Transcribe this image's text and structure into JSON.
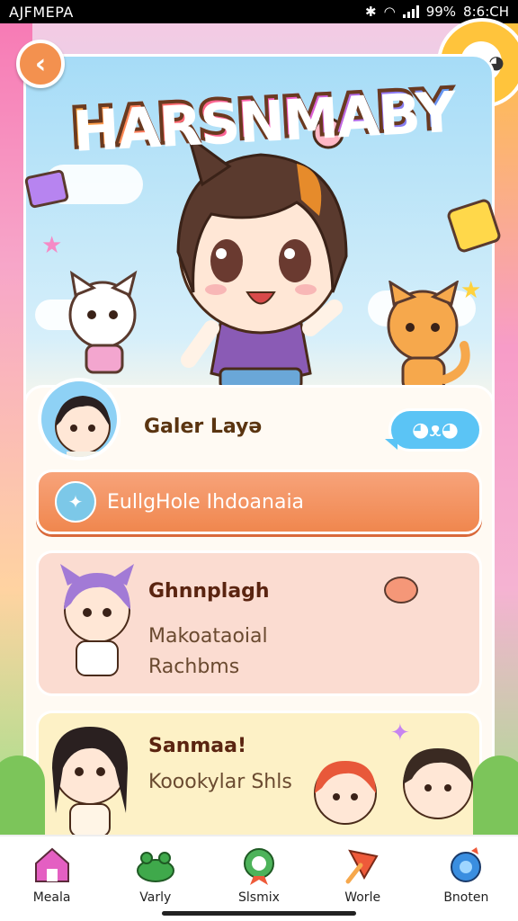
{
  "status_bar": {
    "carrier": "AJFMEPA",
    "battery": "99%",
    "time": "8:6:CH"
  },
  "header": {
    "title": "HARSNMABY",
    "back_icon": "chevron-left-icon"
  },
  "profile": {
    "name": "Galer Layə",
    "chat_icon": "chat-bubble-icon"
  },
  "primary_button": {
    "label": "EullgHole Ihdoanaia",
    "icon": "sparkle-icon"
  },
  "cards": [
    {
      "title": "Ghnnplagh",
      "subtitle_1": "Makoataoial",
      "subtitle_2": "Rachbms"
    },
    {
      "title": "Sanmaa!",
      "subtitle_1": "Koookylar Shls"
    }
  ],
  "bottom_nav": {
    "items": [
      {
        "label": "Meala",
        "icon": "home-icon",
        "color": "#e45fc2"
      },
      {
        "label": "Varly",
        "icon": "frog-icon",
        "color": "#3fa94b"
      },
      {
        "label": "Slsmix",
        "icon": "badge-icon",
        "color": "#4db35a"
      },
      {
        "label": "Worle",
        "icon": "flag-icon",
        "color": "#ee5a3a"
      },
      {
        "label": "Bnoten",
        "icon": "gem-icon",
        "color": "#3a8ee0"
      }
    ]
  },
  "colors": {
    "accent_orange": "#f0874e",
    "accent_blue": "#5bc4f5",
    "card_pink": "#fbdcd1",
    "card_yellow": "#fdf1c6"
  }
}
